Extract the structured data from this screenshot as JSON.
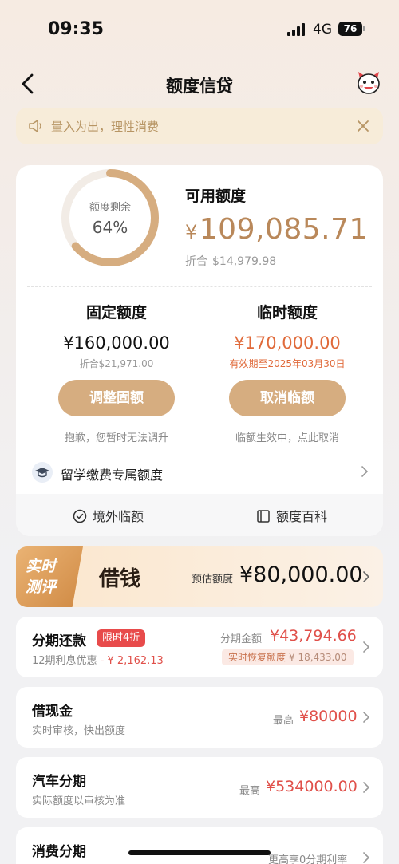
{
  "status_bar": {
    "time": "09:35",
    "network": "4G",
    "battery": "76"
  },
  "nav": {
    "title": "额度信贷",
    "back_icon": "chevron-left-icon",
    "mascot_icon": "mascot-icon"
  },
  "notice": {
    "text": "量入为出，理性消费",
    "icon": "speaker-icon"
  },
  "credit": {
    "ring_label": "额度剩余",
    "ring_percent": "64%",
    "ring_fraction": 0.64,
    "available_label": "可用额度",
    "available_currency": "¥",
    "available_amount": "109,085.71",
    "equivalent_label": "折合",
    "equivalent_amount": "$14,979.98"
  },
  "fixed": {
    "title": "固定额度",
    "amount": "¥160,000.00",
    "sub": "折合$21,971.00",
    "button": "调整固额",
    "note": "抱歉，您暂时无法调升"
  },
  "temp": {
    "title": "临时额度",
    "amount": "¥170,000.00",
    "sub": "有效期至2025年03月30日",
    "button": "取消临额",
    "note": "临额生效中，点此取消"
  },
  "study": {
    "label": "留学缴费专属额度"
  },
  "links": {
    "left": "境外临额",
    "right": "额度百科"
  },
  "borrow": {
    "badge_line1": "实时",
    "badge_line2": "测评",
    "title": "借钱",
    "est_label": "预估额度",
    "est_amount": "¥80,000.00"
  },
  "installment": {
    "title": "分期还款",
    "tag": "限时4折",
    "sub_prefix": "12期利息优惠",
    "sub_amount": "- ¥ 2,162.13",
    "amount_label": "分期金额",
    "amount": "¥43,794.66",
    "restore_label": "实时恢复额度",
    "restore_amount": "¥ 18,433.00"
  },
  "cash": {
    "title": "借现金",
    "sub": "实时审核，快出额度",
    "max_label": "最高",
    "max_amount": "¥80000"
  },
  "car": {
    "title": "汽车分期",
    "sub": "实际额度以审核为准",
    "max_label": "最高",
    "max_amount": "¥534000.00"
  },
  "consumer": {
    "title": "消费分期",
    "right": "更高享0分期利率"
  },
  "colors": {
    "gold": "#b9885a",
    "button": "#d6ad80",
    "red": "#e0504a",
    "orange": "#e06a3a"
  }
}
